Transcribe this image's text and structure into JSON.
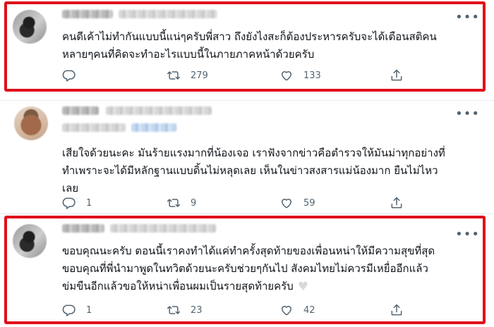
{
  "tweets": [
    {
      "text": "คนดีเค้าไม่ทำกันแบบนี้แน่ๆครับพี่สาว ถึงยังไงสะก็ต้องประหารครับจะได้เตือนสติคน\nหลายๆคนที่คิดจะทำอะไรแบบนี้ในภายภาคหน้าด้วยครับ",
      "replies": "",
      "retweets": "279",
      "likes": "133"
    },
    {
      "text": "เสียใจด้วยนะคะ มันร้ายแรงมากที่น้องเจอ เราฟังจากข่าวคือตำรวจให้มันม่าทุกอย่างที่\nทำเพราะจะได้มีหลักฐานแบบดิ้นไม่หลุดเลย เห็นในข่าวสงสารแม่น้องมาก ยืนไม่ไหว\nเลย",
      "replies": "1",
      "retweets": "9",
      "likes": "59"
    },
    {
      "text": "ขอบคุณนะครับ ตอนนี้เราคงทำได้แค่ทำครั้งสุดท้ายของเพื่อนหน่าให้มีความสุขที่สุด\nขอบคุณที่พี่นำมาพูดในทวิตด้วยนะครับช่วยๆกันไป สังคมไทยไม่ควรมีเหยื่ออีกแล้ว\nข่มขืนอีกแล้วขอให้หน่าเพื่อนผมเป็นรายสุดท้ายครับ",
      "trailing_emoji": "♥",
      "replies": "1",
      "retweets": "23",
      "likes": "42"
    }
  ],
  "more_glyph": "•••",
  "colors": {
    "highlight": "#e0101a",
    "muted": "#536471",
    "divider": "#e6ecf0"
  }
}
